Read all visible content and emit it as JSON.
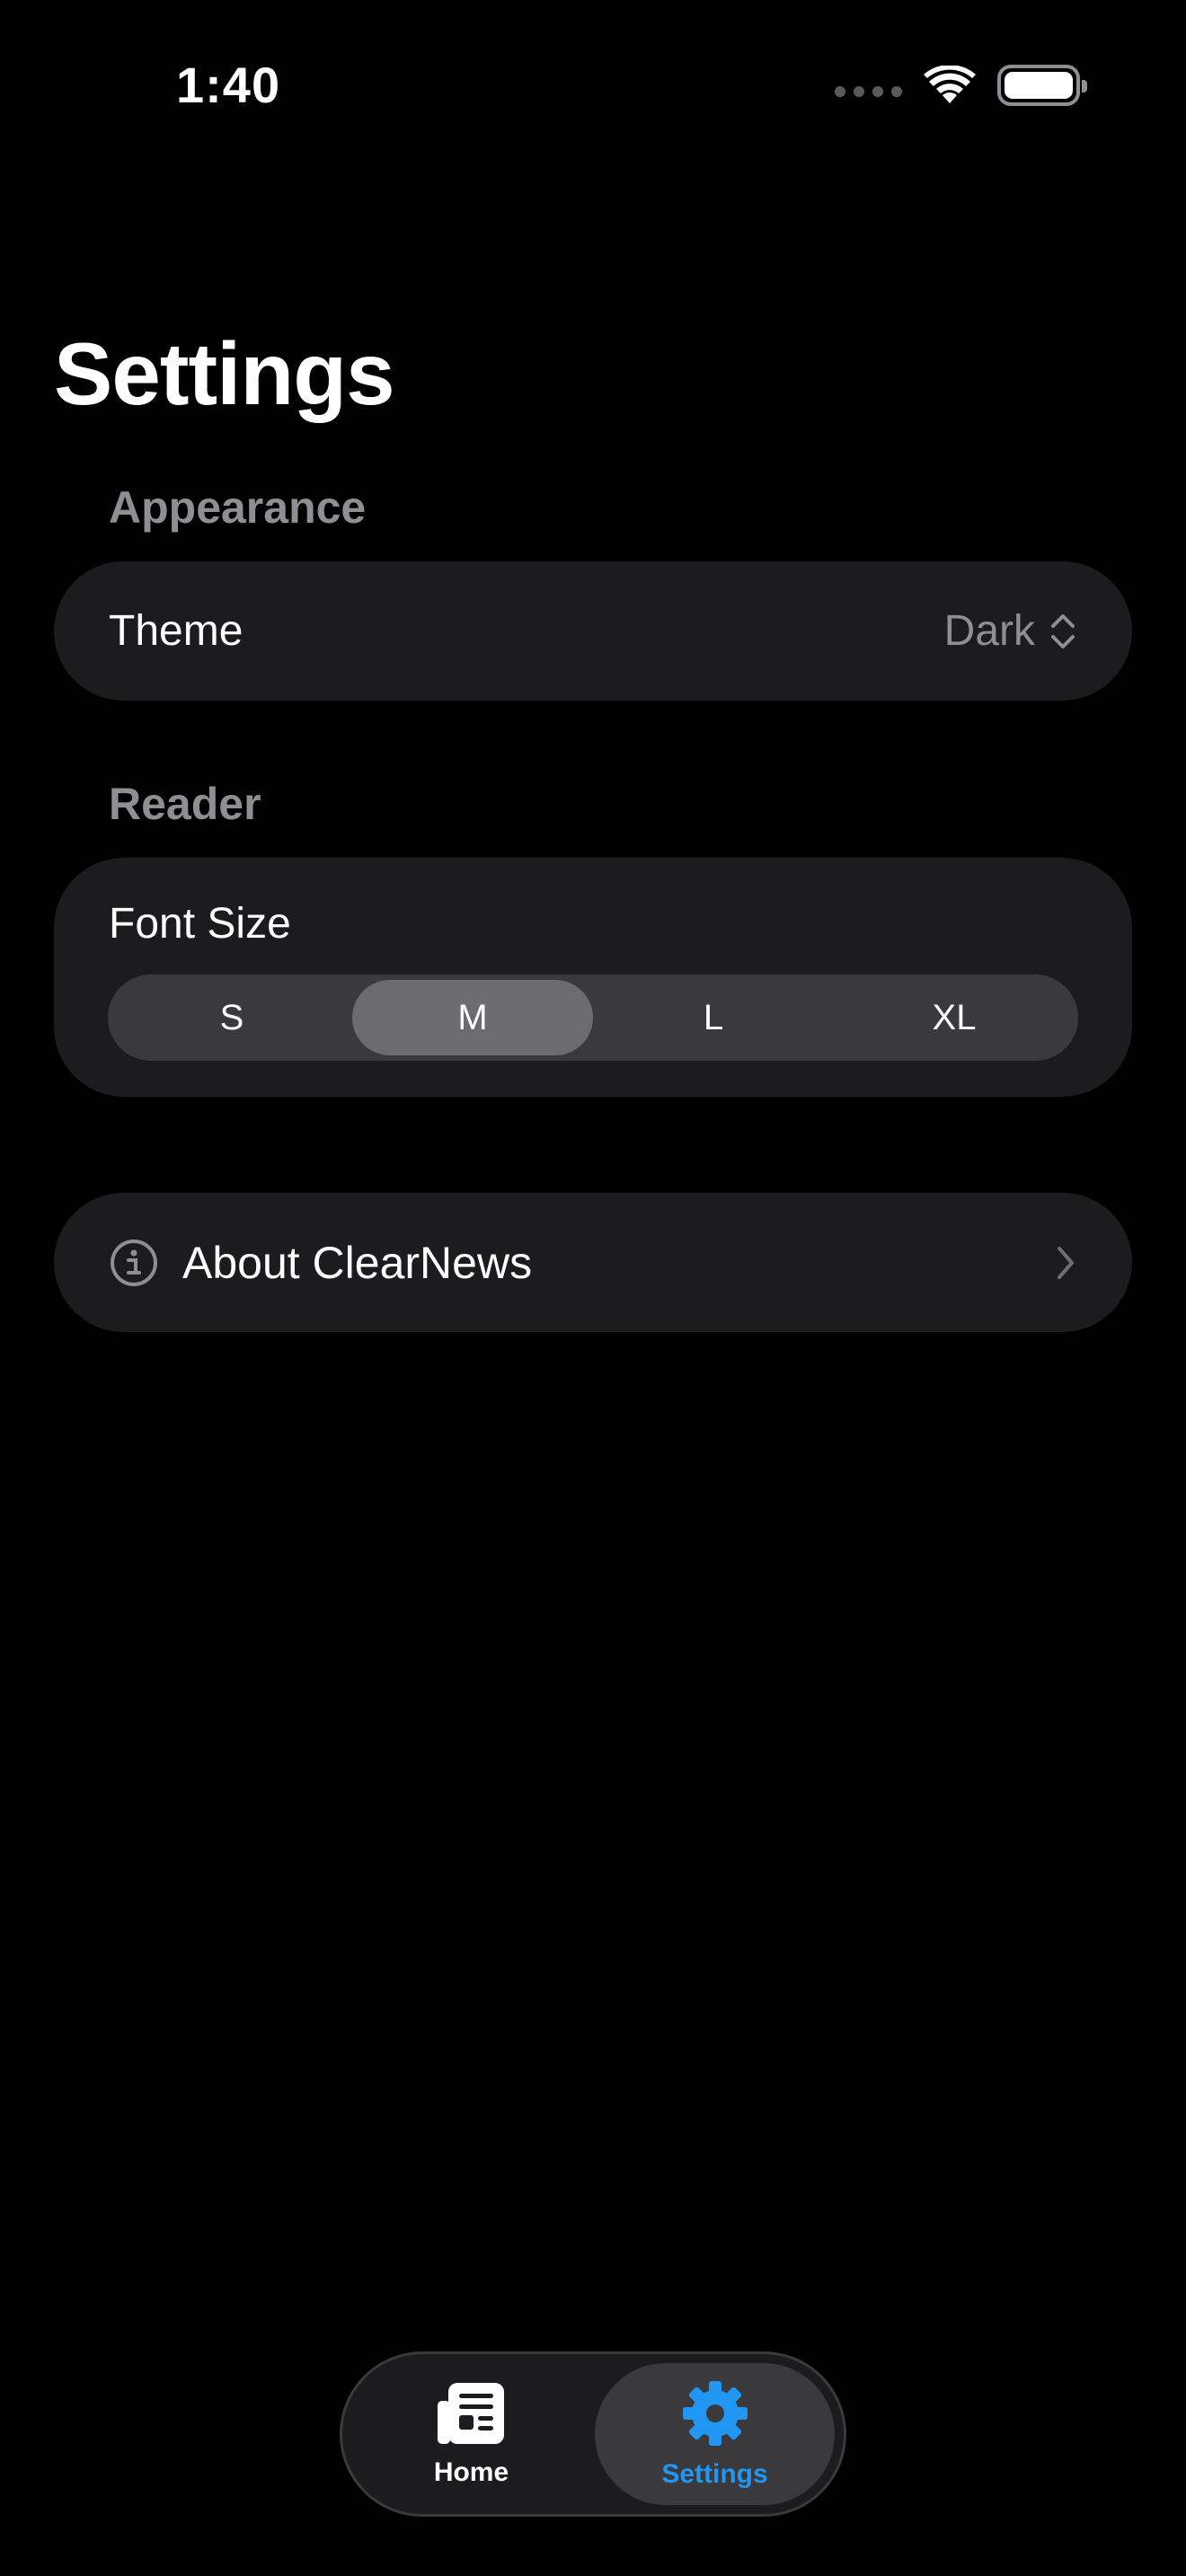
{
  "status_bar": {
    "time": "1:40"
  },
  "header": {
    "title": "Settings"
  },
  "appearance": {
    "section_label": "Appearance",
    "theme_label": "Theme",
    "theme_value": "Dark"
  },
  "reader": {
    "section_label": "Reader",
    "font_size_label": "Font Size",
    "options": [
      "S",
      "M",
      "L",
      "XL"
    ],
    "selected": "M"
  },
  "about": {
    "label": "About ClearNews"
  },
  "tab_bar": {
    "tabs": [
      {
        "label": "Home",
        "icon": "newspaper-icon",
        "active": false
      },
      {
        "label": "Settings",
        "icon": "gear-icon",
        "active": true
      }
    ],
    "accent_color": "#2196f3"
  }
}
